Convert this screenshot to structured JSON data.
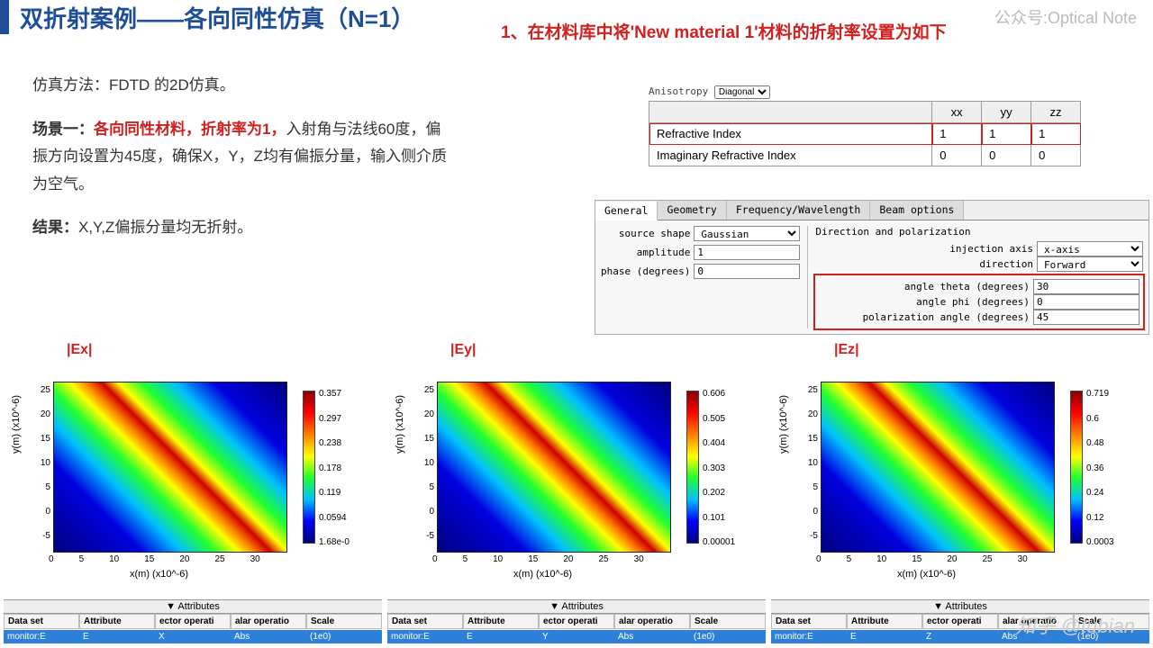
{
  "watermark": "公众号:Optical Note",
  "title": "双折射案例——各向同性仿真（N=1）",
  "red_instruction": "1、在材料库中将'New material 1'材料的折射率设置为如下",
  "left_text": {
    "sim_method_label": "仿真方法：",
    "sim_method_val": "FDTD 的2D仿真。",
    "scene_label": "场景一：",
    "scene_red": "各向同性材料，折射率为1，",
    "scene_rest": "入射角与法线60度，偏振方向设置为45度，确保X，Y，Z均有偏振分量，输入侧介质为空气。",
    "result_label": "结果：",
    "result_val": "X,Y,Z偏振分量均无折射。"
  },
  "material_table": {
    "anisotropy_label": "Anisotropy",
    "anisotropy_value": "Diagonal",
    "cols": [
      "",
      "xx",
      "yy",
      "zz"
    ],
    "rows": [
      {
        "label": "Refractive Index",
        "xx": "1",
        "yy": "1",
        "zz": "1"
      },
      {
        "label": "Imaginary Refractive Index",
        "xx": "0",
        "yy": "0",
        "zz": "0"
      }
    ]
  },
  "source_panel": {
    "tabs": [
      "General",
      "Geometry",
      "Frequency/Wavelength",
      "Beam options"
    ],
    "active_tab": 0,
    "left": {
      "source_shape_label": "source shape",
      "source_shape": "Gaussian",
      "amplitude_label": "amplitude",
      "amplitude": "1",
      "phase_label": "phase (degrees)",
      "phase": "0"
    },
    "right": {
      "header": "Direction and polarization",
      "injection_axis_label": "injection axis",
      "injection_axis": "x-axis",
      "direction_label": "direction",
      "direction": "Forward",
      "theta_label": "angle theta (degrees)",
      "theta": "30",
      "phi_label": "angle phi (degrees)",
      "phi": "0",
      "pol_label": "polarization angle (degrees)",
      "pol": "45"
    }
  },
  "chart_axes": {
    "xlabel": "x(m) (x10^-6)",
    "ylabel": "y(m) (x10^-6)",
    "yticks": [
      "25",
      "20",
      "15",
      "10",
      "5",
      "0",
      "-5"
    ],
    "xticks": [
      "0",
      "5",
      "10",
      "15",
      "20",
      "25",
      "30"
    ],
    "attributes_label": "Attributes",
    "attr_headers": [
      "Data set",
      "Attribute",
      "ector operati",
      "alar operatio",
      "Scale"
    ]
  },
  "chart_data": [
    {
      "title": "|Ex|",
      "type": "heatmap",
      "xlim": [
        0,
        30
      ],
      "ylim": [
        -5,
        25
      ],
      "xlabel": "x(m) (x10^-6)",
      "ylabel": "y(m) (x10^-6)",
      "colorbar": [
        "0.357",
        "0.297",
        "0.238",
        "0.178",
        "0.119",
        "0.0594",
        "1.68e-0"
      ],
      "attr_row": {
        "dataset": "monitor:E",
        "attribute": "E",
        "vec": "X",
        "scal": "Abs",
        "scale": "(1e0)"
      }
    },
    {
      "title": "|Ey|",
      "type": "heatmap",
      "xlim": [
        0,
        30
      ],
      "ylim": [
        -5,
        25
      ],
      "xlabel": "x(m) (x10^-6)",
      "ylabel": "y(m) (x10^-6)",
      "colorbar": [
        "0.606",
        "0.505",
        "0.404",
        "0.303",
        "0.202",
        "0.101",
        "0.00001"
      ],
      "attr_row": {
        "dataset": "monitor:E",
        "attribute": "E",
        "vec": "Y",
        "scal": "Abs",
        "scale": "(1e0)"
      }
    },
    {
      "title": "|Ez|",
      "type": "heatmap",
      "xlim": [
        0,
        30
      ],
      "ylim": [
        -5,
        25
      ],
      "xlabel": "x(m) (x10^-6)",
      "ylabel": "y(m) (x10^-6)",
      "colorbar": [
        "0.719",
        "0.6",
        "0.48",
        "0.36",
        "0.24",
        "0.12",
        "0.0003"
      ],
      "attr_row": {
        "dataset": "monitor:E",
        "attribute": "E",
        "vec": "Z",
        "scal": "Abs",
        "scale": "(1e0)"
      }
    }
  ],
  "zhihu": "知乎 @tubian"
}
